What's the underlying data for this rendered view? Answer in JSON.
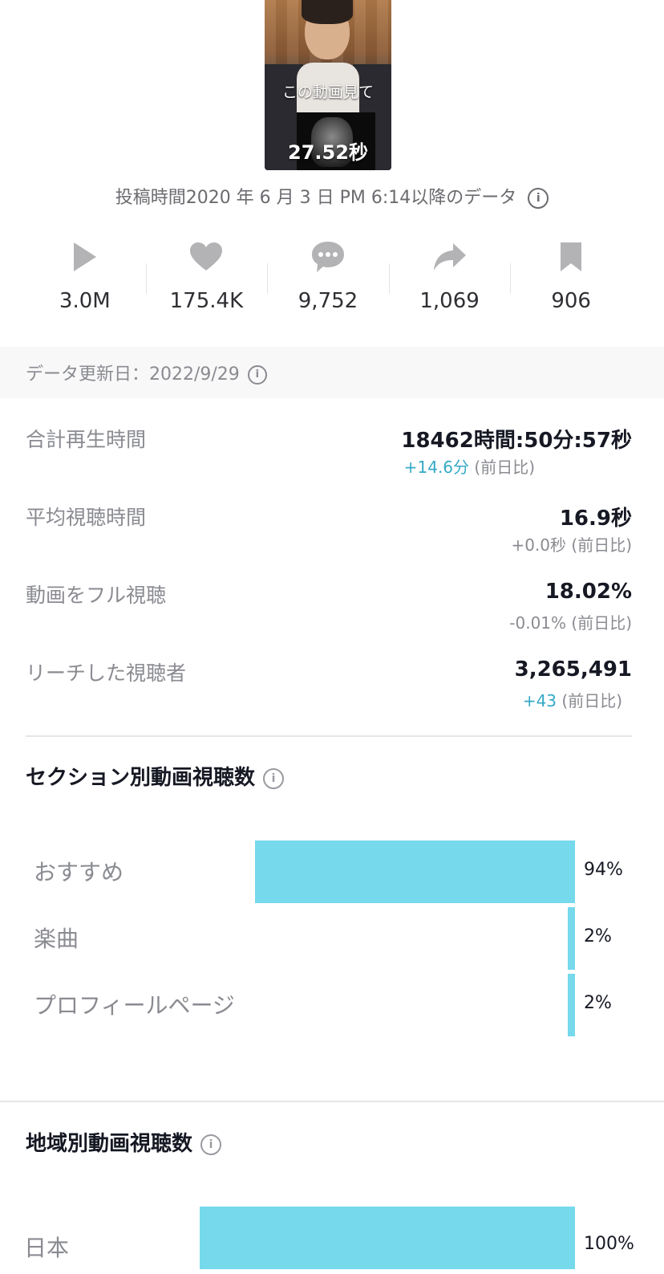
{
  "video": {
    "caption": "この動画見て",
    "duration": "27.52秒"
  },
  "posted_text": "投稿時間2020 年 6 月 3 日 PM 6:14以降のデータ",
  "stats": [
    {
      "icon": "play-icon",
      "value": "3.0M"
    },
    {
      "icon": "heart-icon",
      "value": "175.4K"
    },
    {
      "icon": "comment-icon",
      "value": "9,752"
    },
    {
      "icon": "share-icon",
      "value": "1,069"
    },
    {
      "icon": "bookmark-icon",
      "value": "906"
    }
  ],
  "updated_text": "データ更新日：2022/9/29",
  "metrics": [
    {
      "label": "合計再生時間",
      "value": "18462時間:50分:57秒",
      "delta": "+14.6分",
      "delta_suffix": " (前日比)",
      "delta_positive": true
    },
    {
      "label": "平均視聴時間",
      "value": "16.9秒",
      "delta": "+0.0秒",
      "delta_suffix": " (前日比)",
      "delta_positive": false
    },
    {
      "label": "動画をフル視聴",
      "value": "18.02%",
      "delta": "-0.01%",
      "delta_suffix": " (前日比)",
      "delta_positive": false
    },
    {
      "label": "リーチした視聴者",
      "value": "3,265,491",
      "delta": "+43",
      "delta_suffix": " (前日比)",
      "delta_positive": true
    }
  ],
  "section_views": {
    "title": "セクション別動画視聴数",
    "rows": [
      {
        "label": "おすすめ",
        "percent_text": "94%",
        "value": 0.94
      },
      {
        "label": "楽曲",
        "percent_text": "2%",
        "value": 0.02
      },
      {
        "label": "プロフィールページ",
        "percent_text": "2%",
        "value": 0.02
      }
    ]
  },
  "region_views": {
    "title": "地域別動画視聴数",
    "rows": [
      {
        "label": "日本",
        "percent_text": "100%",
        "value": 1.0
      }
    ]
  },
  "colors": {
    "bar": "#76d9ec",
    "positive_delta": "#35a9c6",
    "secondary_text": "#8a8b91"
  }
}
